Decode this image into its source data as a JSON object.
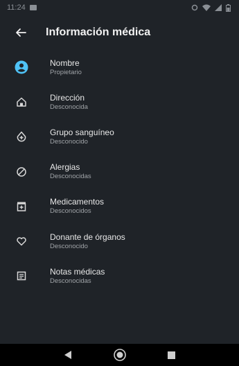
{
  "status_bar": {
    "time": "11:24"
  },
  "header": {
    "title": "Información médica"
  },
  "items": [
    {
      "icon": "account-circle-icon",
      "title": "Nombre",
      "subtitle": "Propietario"
    },
    {
      "icon": "home-icon",
      "title": "Dirección",
      "subtitle": "Desconocida"
    },
    {
      "icon": "blood-drop-icon",
      "title": "Grupo sanguíneo",
      "subtitle": "Desconocido"
    },
    {
      "icon": "block-icon",
      "title": "Alergias",
      "subtitle": "Desconocidas"
    },
    {
      "icon": "medication-icon",
      "title": "Medicamentos",
      "subtitle": "Desconocidos"
    },
    {
      "icon": "heart-icon",
      "title": "Donante de órganos",
      "subtitle": "Desconocido"
    },
    {
      "icon": "notes-icon",
      "title": "Notas médicas",
      "subtitle": "Desconocidas"
    }
  ],
  "colors": {
    "background": "#1f2328",
    "accent": "#4fc3f7",
    "text": "#e6e6e6",
    "subtext": "#a0a4a8"
  }
}
